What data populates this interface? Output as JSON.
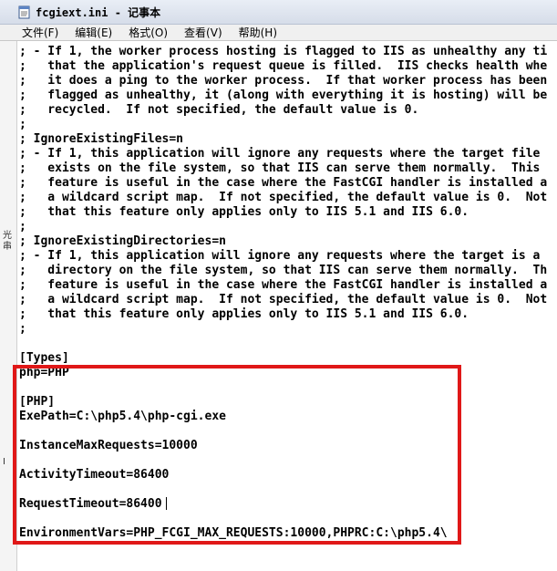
{
  "window": {
    "title": "fcgiext.ini - 记事本"
  },
  "menubar": {
    "items": [
      {
        "label": "文件(F)"
      },
      {
        "label": "编辑(E)"
      },
      {
        "label": "格式(O)"
      },
      {
        "label": "查看(V)"
      },
      {
        "label": "帮助(H)"
      }
    ]
  },
  "editor": {
    "lines": [
      "; - If 1, the worker process hosting is flagged to IIS as unhealthy any ti",
      ";   that the application's request queue is filled.  IIS checks health whe",
      ";   it does a ping to the worker process.  If that worker process has been",
      ";   flagged as unhealthy, it (along with everything it is hosting) will be",
      ";   recycled.  If not specified, the default value is 0.",
      ";",
      "; IgnoreExistingFiles=n",
      "; - If 1, this application will ignore any requests where the target file",
      ";   exists on the file system, so that IIS can serve them normally.  This",
      ";   feature is useful in the case where the FastCGI handler is installed a",
      ";   a wildcard script map.  If not specified, the default value is 0.  Not",
      ";   that this feature only applies only to IIS 5.1 and IIS 6.0.",
      ";",
      "; IgnoreExistingDirectories=n",
      "; - If 1, this application will ignore any requests where the target is a",
      ";   directory on the file system, so that IIS can serve them normally.  Th",
      ";   feature is useful in the case where the FastCGI handler is installed a",
      ";   a wildcard script map.  If not specified, the default value is 0.  Not",
      ";   that this feature only applies only to IIS 5.1 and IIS 6.0.",
      ";",
      "",
      "[Types]",
      "php=PHP",
      "",
      "[PHP]",
      "ExePath=C:\\php5.4\\php-cgi.exe",
      "",
      "InstanceMaxRequests=10000",
      "",
      "ActivityTimeout=86400",
      "",
      "RequestTimeout=86400",
      "",
      "EnvironmentVars=PHP_FCGI_MAX_REQUESTS:10000,PHPRC:C:\\php5.4\\"
    ]
  },
  "left_strip": {
    "marks": [
      "光",
      "串",
      "I"
    ]
  },
  "colors": {
    "highlight_border": "#e01818",
    "menubar_bg": "#f0f0f0",
    "titlebar_bg": "#dfe5ef"
  },
  "icons": {
    "app": "notepad-icon"
  }
}
